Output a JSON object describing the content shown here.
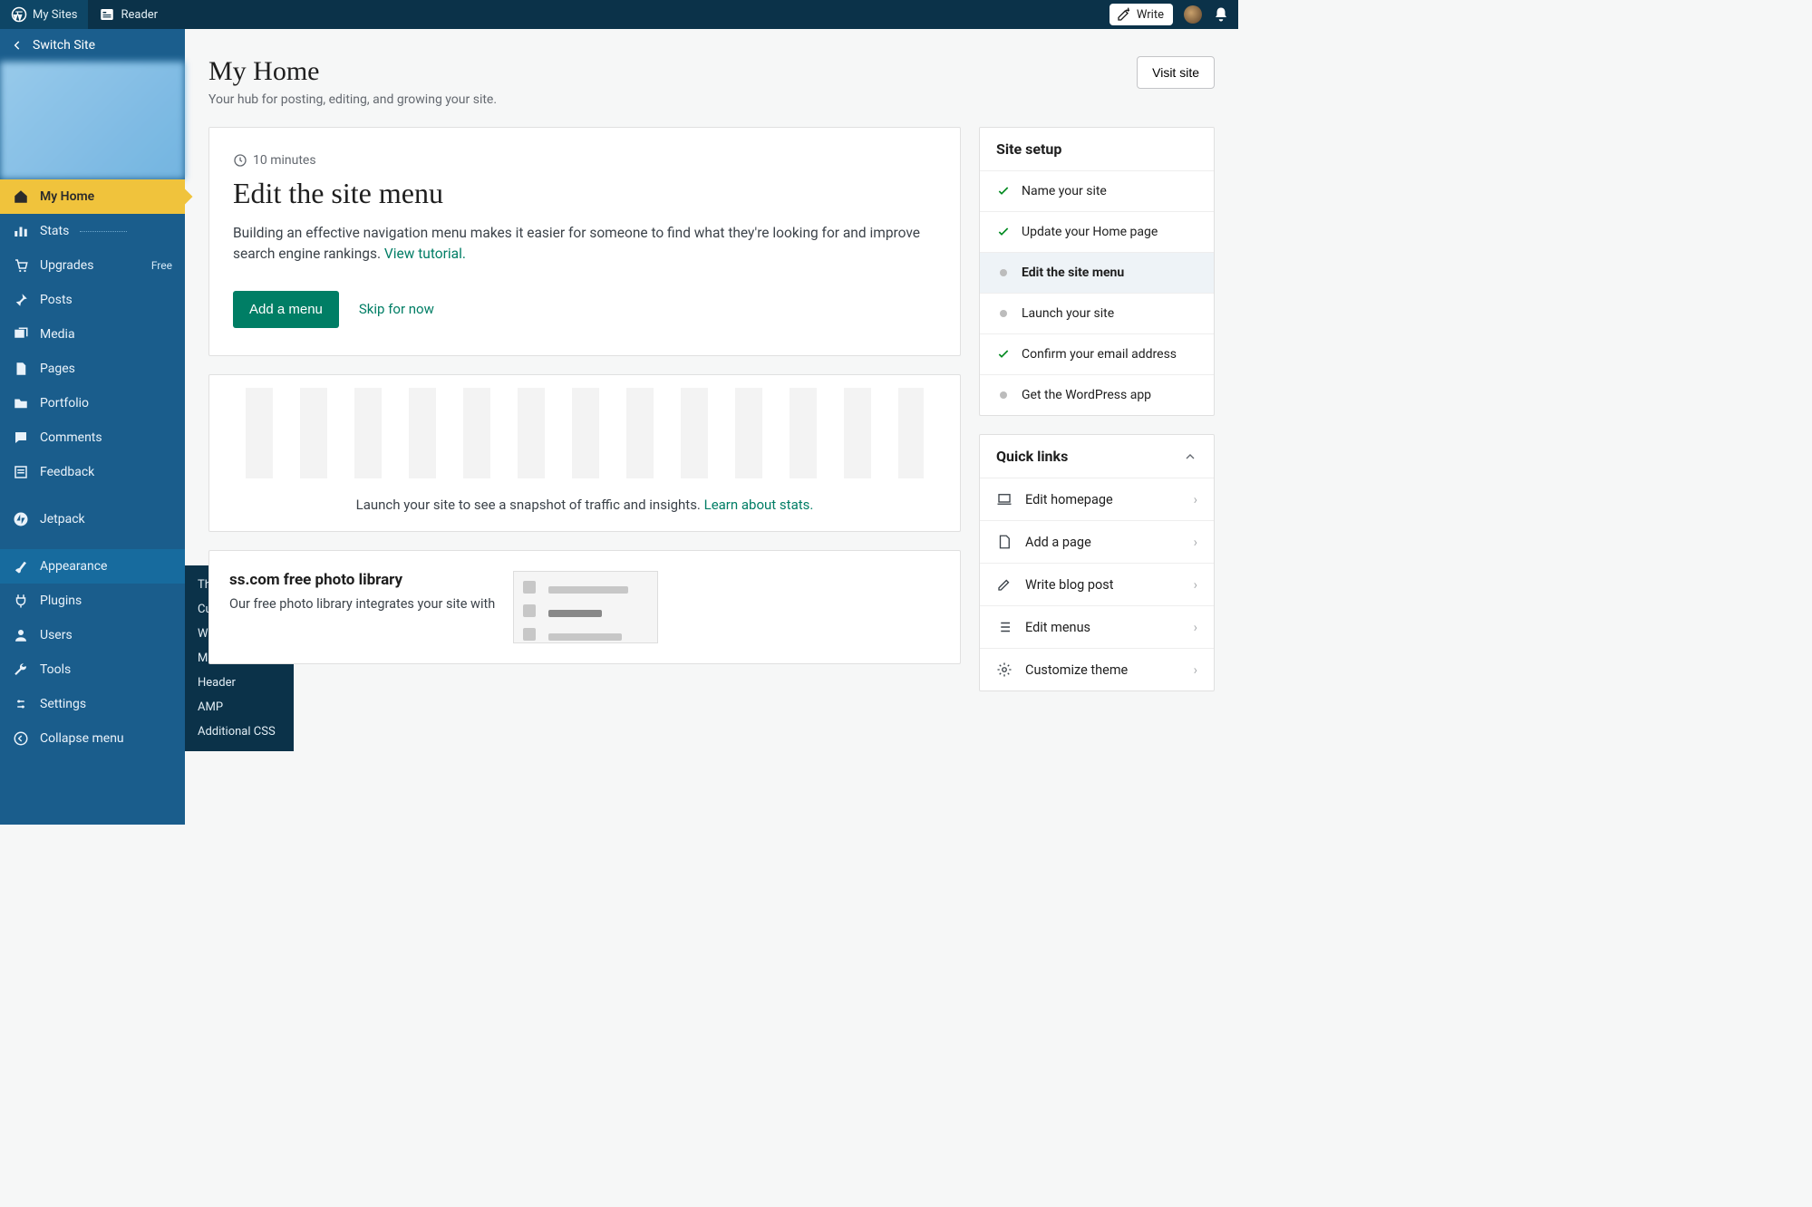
{
  "masterbar": {
    "my_sites": "My Sites",
    "reader": "Reader",
    "write": "Write"
  },
  "sidebar": {
    "switch_site": "Switch Site",
    "items": [
      {
        "label": "My Home",
        "icon": "home"
      },
      {
        "label": "Stats",
        "icon": "stats"
      },
      {
        "label": "Upgrades",
        "icon": "cart",
        "badge": "Free"
      },
      {
        "label": "Posts",
        "icon": "pin"
      },
      {
        "label": "Media",
        "icon": "media"
      },
      {
        "label": "Pages",
        "icon": "page"
      },
      {
        "label": "Portfolio",
        "icon": "folder"
      },
      {
        "label": "Comments",
        "icon": "comment"
      },
      {
        "label": "Feedback",
        "icon": "form"
      },
      {
        "label": "Jetpack",
        "icon": "jetpack"
      },
      {
        "label": "Appearance",
        "icon": "brush"
      },
      {
        "label": "Plugins",
        "icon": "plug"
      },
      {
        "label": "Users",
        "icon": "user"
      },
      {
        "label": "Tools",
        "icon": "wrench"
      },
      {
        "label": "Settings",
        "icon": "settings"
      },
      {
        "label": "Collapse menu",
        "icon": "collapse"
      }
    ]
  },
  "flyout": [
    "Themes",
    "Customize",
    "Widgets",
    "Menus",
    "Header",
    "AMP",
    "Additional CSS"
  ],
  "page": {
    "title": "My Home",
    "subtitle": "Your hub for posting, editing, and growing your site.",
    "visit": "Visit site"
  },
  "task": {
    "time_label": "10 minutes",
    "title": "Edit the site menu",
    "body": "Building an effective navigation menu makes it easier for someone to find what they're looking for and improve search engine rankings. ",
    "view_tutorial": "View tutorial.",
    "primary": "Add a menu",
    "skip": "Skip for now"
  },
  "setup": {
    "heading": "Site setup",
    "items": [
      {
        "label": "Name your site",
        "done": true
      },
      {
        "label": "Update your Home page",
        "done": true
      },
      {
        "label": "Edit the site menu",
        "done": false,
        "active": true
      },
      {
        "label": "Launch your site",
        "done": false
      },
      {
        "label": "Confirm your email address",
        "done": true
      },
      {
        "label": "Get the WordPress app",
        "done": false
      }
    ]
  },
  "stats": {
    "text_before": "Launch your site to see a snapshot of traffic and insights. ",
    "link": "Learn about stats."
  },
  "quicklinks": {
    "heading": "Quick links",
    "items": [
      {
        "label": "Edit homepage",
        "icon": "laptop"
      },
      {
        "label": "Add a page",
        "icon": "page"
      },
      {
        "label": "Write blog post",
        "icon": "pencil"
      },
      {
        "label": "Edit menus",
        "icon": "list"
      },
      {
        "label": "Customize theme",
        "icon": "gear"
      }
    ]
  },
  "photolib": {
    "title_suffix": "ss.com free photo library",
    "body": "Our free photo library integrates your site with"
  }
}
